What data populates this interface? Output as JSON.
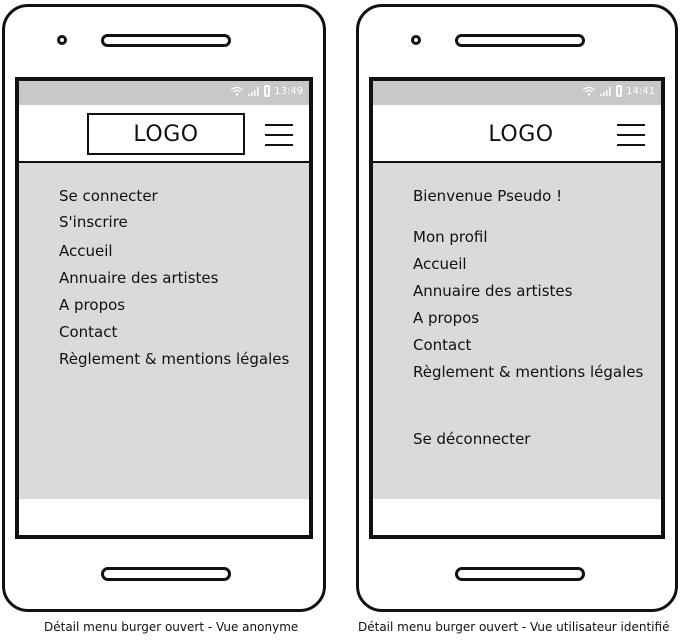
{
  "anonymous_view": {
    "time": "13:49",
    "logo": "LOGO",
    "menu_items": [
      "Se connecter",
      "S'inscrire",
      "Accueil",
      "Annuaire des artistes",
      "A propos",
      "Contact",
      "Règlement & mentions légales"
    ],
    "caption": "Détail menu burger ouvert - Vue anonyme"
  },
  "identified_view": {
    "time": "14:41",
    "logo": "LOGO",
    "welcome": "Bienvenue Pseudo !",
    "menu_items": [
      "Mon profil",
      "Accueil",
      "Annuaire des artistes",
      "A propos",
      "Contact",
      "Règlement & mentions légales"
    ],
    "logout": "Se déconnecter",
    "caption": "Détail menu burger ouvert - Vue utilisateur identifié"
  },
  "icons": [
    "camera-icon",
    "speaker-icon",
    "wifi-icon",
    "signal-icon",
    "battery-icon",
    "burger-menu-icon",
    "home-button-icon"
  ],
  "colors": {
    "status_bar": "#c8c8c8",
    "menu_background": "#dadada",
    "outline": "#111111"
  }
}
